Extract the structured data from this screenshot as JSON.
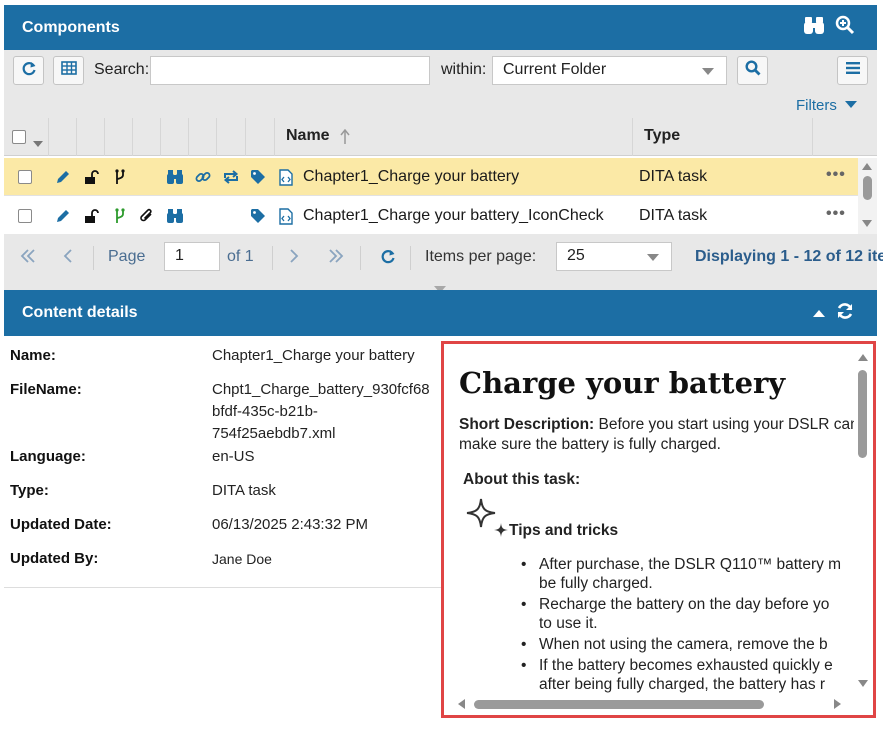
{
  "components_panel": {
    "title": "Components",
    "header_icons": [
      "binoculars-icon",
      "zoom-in-icon"
    ]
  },
  "toolbar": {
    "search_label": "Search:",
    "search_value": "",
    "within_label": "within:",
    "within_value": "Current Folder",
    "filters_label": "Filters"
  },
  "grid": {
    "columns": {
      "name": "Name",
      "type": "Type"
    },
    "rows": [
      {
        "name": "Chapter1_Charge your battery",
        "type": "DITA task",
        "selected": true,
        "icons": [
          "pencil-icon",
          "unlock-icon",
          "branch-icon",
          "binoculars-icon",
          "link-icon",
          "sync-icon",
          "tag-icon",
          "file-code-icon"
        ]
      },
      {
        "name": "Chapter1_Charge your battery_IconCheck",
        "type": "DITA task",
        "selected": false,
        "icons": [
          "pencil-icon",
          "unlock-icon",
          "branch-icon",
          "paperclip-icon",
          "binoculars-icon",
          "tag-icon",
          "file-code-icon"
        ]
      }
    ],
    "more_label": "•••"
  },
  "pager": {
    "page_label": "Page",
    "page_value": "1",
    "of_label": "of 1",
    "items_per_page_label": "Items per page:",
    "items_per_page_value": "25",
    "displaying": "Displaying 1 - 12 of 12 ite"
  },
  "details_panel": {
    "title": "Content details",
    "fields": [
      {
        "label": "Name:",
        "value": "Chapter1_Charge your battery"
      },
      {
        "label": "FileName:",
        "value": "Chpt1_Charge_battery_930fcf68"
      },
      {
        "label": "",
        "value": "bfdf-435c-b21b-"
      },
      {
        "label": "",
        "value": "754f25aebdb7.xml"
      },
      {
        "label": "Language:",
        "value": "en-US"
      },
      {
        "label": "Type:",
        "value": "DITA task"
      },
      {
        "label": "Updated Date:",
        "value": "06/13/2025 2:43:32 PM"
      },
      {
        "label": "Updated By:",
        "value": "Jane Doe"
      }
    ]
  },
  "preview": {
    "title": "Charge your battery",
    "short_desc_label": "Short Description:",
    "short_desc_text": "Before you start using your DSLR camera, make sure the battery is fully charged.",
    "about_label": "About this task:",
    "tips_label": "Tips and tricks",
    "bullets": [
      "After purchase, the DSLR Q110™ battery m",
      "be fully charged.",
      "Recharge the battery on the day before yo",
      "to use it.",
      "When not using the camera, remove the b",
      "If the battery becomes exhausted quickly e",
      "after being fully charged, the battery has r"
    ]
  },
  "colors": {
    "header_blue": "#1c6ea4",
    "selected_row": "#fbe9a6",
    "icon_blue": "#1c6ea4",
    "icon_green": "#2e9b2e",
    "highlight_border": "#e04545"
  }
}
